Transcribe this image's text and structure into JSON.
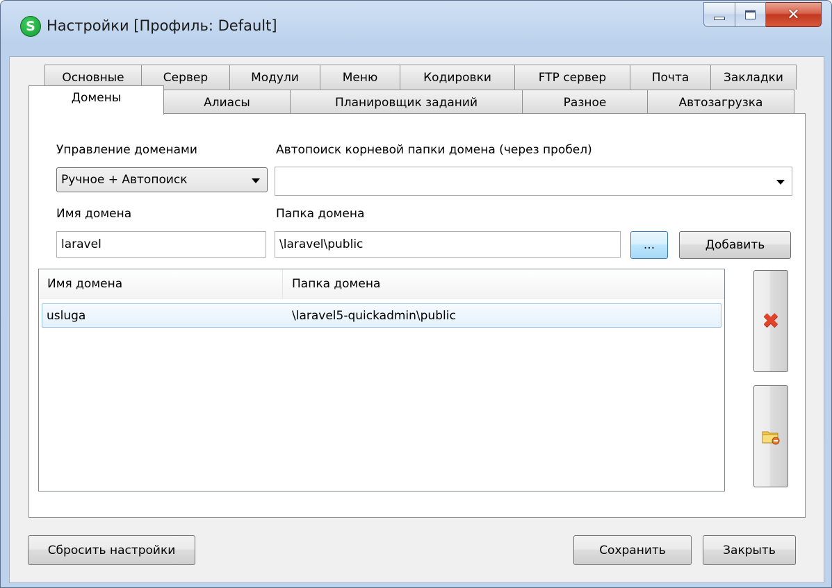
{
  "window": {
    "title": "Настройки [Профиль: Default]",
    "app_icon_letter": "S"
  },
  "tabs": {
    "row1": [
      "Основные",
      "Сервер",
      "Модули",
      "Меню",
      "Кодировки",
      "FTP сервер",
      "Почта",
      "Закладки"
    ],
    "row2": [
      "Домены",
      "Алиасы",
      "Планировщик заданий",
      "Разное",
      "Автозагрузка"
    ],
    "selected": "Домены"
  },
  "domains": {
    "management_label": "Управление доменами",
    "management_value": "Ручное + Автопоиск",
    "autosearch_label": "Автопоиск корневой папки домена (через пробел)",
    "autosearch_value": "",
    "name_label": "Имя домена",
    "name_value": "laravel",
    "folder_label": "Папка домена",
    "folder_value": "\\laravel\\public",
    "browse_label": "...",
    "add_label": "Добавить"
  },
  "table": {
    "columns": [
      "Имя домена",
      "Папка домена"
    ],
    "rows": [
      {
        "name": "usluga",
        "folder": "\\laravel5-quickadmin\\public"
      }
    ]
  },
  "footer": {
    "reset_label": "Сбросить настройки",
    "save_label": "Сохранить",
    "close_label": "Закрыть"
  },
  "icons": {
    "delete": "delete-x-icon",
    "folder": "folder-remove-icon"
  },
  "colors": {
    "accent_blue": "#3c7fb1",
    "delete_red": "#e0442a",
    "folder_yellow": "#f2c94c",
    "app_green": "#1fa83f",
    "close_red": "#c2381f"
  }
}
